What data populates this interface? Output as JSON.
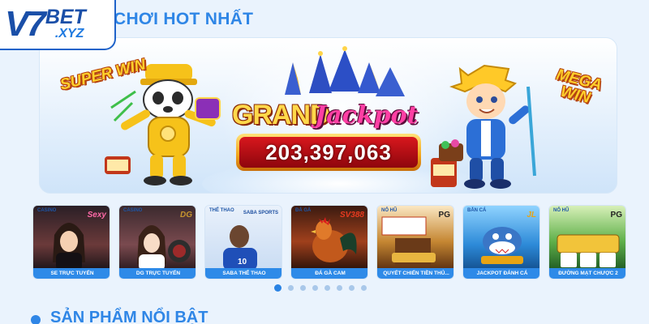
{
  "logo": {
    "mark": "V7",
    "bet": "BET",
    "tld": ".XYZ"
  },
  "sections": {
    "hot_games_title": "CHƠI HOT NHẤT",
    "featured_title": "SẢN PHẨM NỔI BẬT"
  },
  "banner": {
    "super_win": "SUPER WIN",
    "mega_win": "MEGA WIN",
    "grand": "GRAND",
    "jackpot": "Jackpot",
    "jackpot_value": "203,397,063"
  },
  "games": [
    {
      "category": "CASINO",
      "brand": "Sexy",
      "label": "SE TRỰC TUYẾN",
      "color": "#ff6aa8"
    },
    {
      "category": "CASINO",
      "brand": "DG",
      "label": "DG TRỰC TUYẾN",
      "color": "#c8962e"
    },
    {
      "category": "THỂ THAO",
      "brand": "SABA SPORTS",
      "label": "SABA THỂ THAO",
      "color": "#1d4fa0"
    },
    {
      "category": "ĐÁ GÀ",
      "brand": "SV388",
      "label": "ĐÁ GÀ CAM",
      "color": "#e63a1f"
    },
    {
      "category": "NỔ HŨ",
      "brand": "PG",
      "label": "QUYẾT CHIẾN TIỀN THỦ...",
      "color": "#222222"
    },
    {
      "category": "BẮN CÁ",
      "brand": "JL",
      "label": "JACKPOT ĐÁNH CÁ",
      "color": "#e8a413"
    },
    {
      "category": "NỔ HŨ",
      "brand": "PG",
      "label": "ĐƯỜNG MẠT CHƯỢC 2",
      "color": "#222222"
    }
  ],
  "pagination": {
    "pages": 8,
    "active_index": 0
  }
}
